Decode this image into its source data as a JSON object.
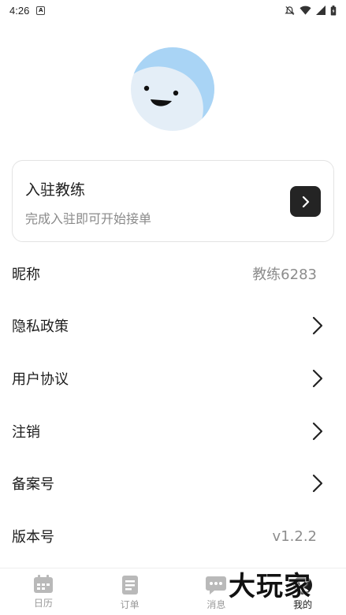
{
  "status_bar": {
    "time": "4:26"
  },
  "join_card": {
    "title": "入驻教练",
    "subtitle": "完成入驻即可开始接单"
  },
  "rows": {
    "nickname": {
      "label": "昵称",
      "value": "教练6283"
    },
    "privacy": {
      "label": "隐私政策"
    },
    "agreement": {
      "label": "用户协议"
    },
    "cancel": {
      "label": "注销"
    },
    "record": {
      "label": "备案号"
    },
    "version": {
      "label": "版本号",
      "value": "v1.2.2"
    }
  },
  "tabbar": {
    "tabs": [
      {
        "label": "日历",
        "icon": "calendar-icon"
      },
      {
        "label": "订单",
        "icon": "document-icon"
      },
      {
        "label": "消息",
        "icon": "chat-icon"
      },
      {
        "label": "我的",
        "icon": "profile-icon",
        "active": true
      }
    ]
  },
  "watermark": "大玩家",
  "colors": {
    "avatar_bg": "#e4eef7",
    "avatar_wave": "#a9d4f5",
    "tab_icon": "#b9b9b9",
    "tab_active": "#1a1a1a"
  }
}
